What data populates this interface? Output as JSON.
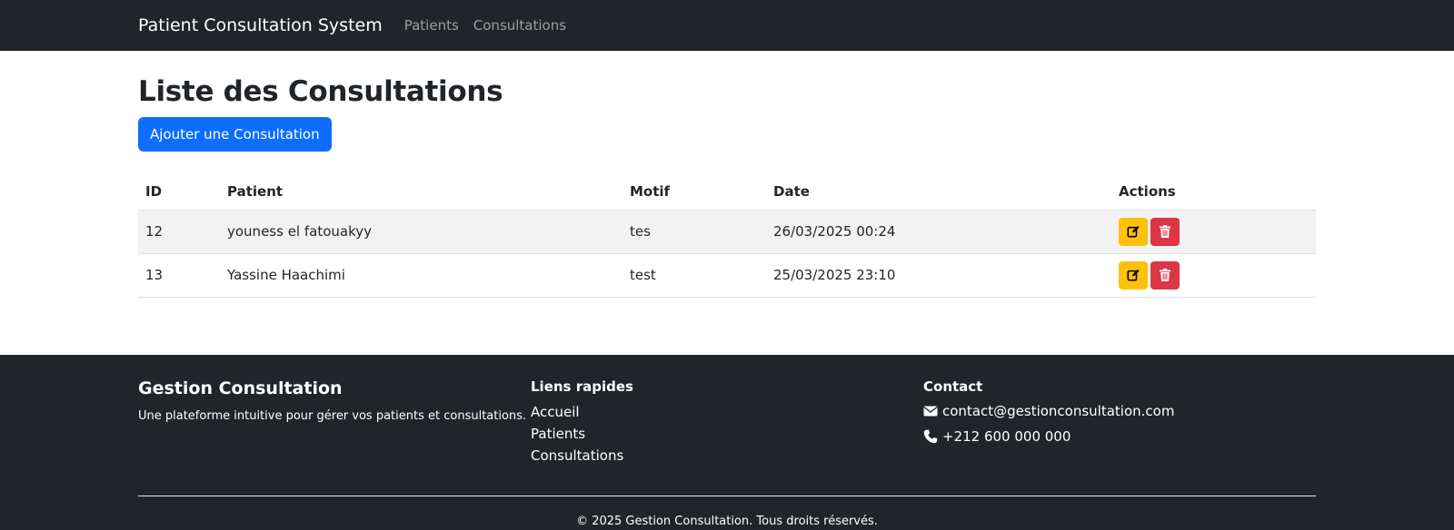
{
  "navbar": {
    "brand": "Patient Consultation System",
    "links": [
      "Patients",
      "Consultations"
    ]
  },
  "page": {
    "title": "Liste des Consultations",
    "add_button": "Ajouter une Consultation"
  },
  "table": {
    "headers": [
      "ID",
      "Patient",
      "Motif",
      "Date",
      "Actions"
    ],
    "rows": [
      {
        "id": "12",
        "patient": "youness el fatouakyy",
        "motif": "tes",
        "date": "26/03/2025 00:24"
      },
      {
        "id": "13",
        "patient": "Yassine Haachimi",
        "motif": "test",
        "date": "25/03/2025 23:10"
      }
    ]
  },
  "footer": {
    "brand": "Gestion Consultation",
    "description": "Une plateforme intuitive pour gérer vos patients et consultations.",
    "links_heading": "Liens rapides",
    "links": [
      "Accueil",
      "Patients",
      "Consultations"
    ],
    "contact_heading": "Contact",
    "email": "contact@gestionconsultation.com",
    "phone": "+212 600 000 000",
    "copyright": "© 2025 Gestion Consultation. Tous droits réservés."
  },
  "colors": {
    "navbar_bg": "#212529",
    "primary": "#0d6efd",
    "warning": "#ffc107",
    "danger": "#dc3545"
  },
  "icons": [
    "edit-icon",
    "trash-icon",
    "envelope-icon",
    "phone-icon"
  ]
}
